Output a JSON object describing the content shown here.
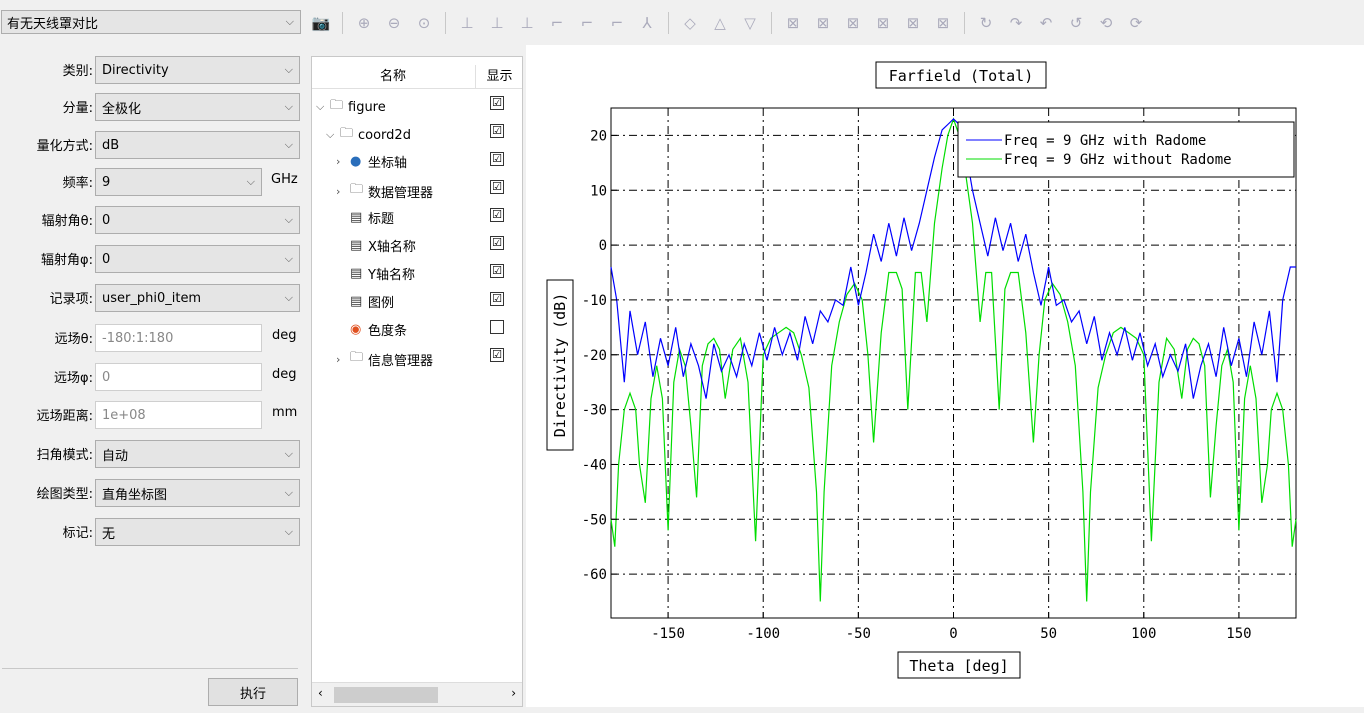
{
  "top_combo": "有无天线罩对比",
  "form": {
    "category_label": "类别:",
    "category_value": "Directivity",
    "component_label": "分量:",
    "component_value": "全极化",
    "quant_label": "量化方式:",
    "quant_value": "dB",
    "freq_label": "频率:",
    "freq_value": "9",
    "freq_unit": "GHz",
    "theta_label": "辐射角θ:",
    "theta_value": "0",
    "phi_label": "辐射角φ:",
    "phi_value": "0",
    "record_label": "记录项:",
    "record_value": "user_phi0_item",
    "ff_theta_label": "远场θ:",
    "ff_theta_value": "-180:1:180",
    "ff_theta_unit": "deg",
    "ff_phi_label": "远场φ:",
    "ff_phi_value": "0",
    "ff_phi_unit": "deg",
    "ff_dist_label": "远场距离:",
    "ff_dist_value": "1e+08",
    "ff_dist_unit": "mm",
    "scan_label": "扫角模式:",
    "scan_value": "自动",
    "plot_type_label": "绘图类型:",
    "plot_type_value": "直角坐标图",
    "marker_label": "标记:",
    "marker_value": "无",
    "exec_label": "执行"
  },
  "tree": {
    "col_name": "名称",
    "col_show": "显示",
    "items": [
      {
        "label": "figure",
        "checked": "☑"
      },
      {
        "label": "coord2d",
        "checked": "☑"
      },
      {
        "label": "坐标轴",
        "checked": "☑"
      },
      {
        "label": "数据管理器",
        "checked": "☑"
      },
      {
        "label": "标题",
        "checked": "☑"
      },
      {
        "label": "X轴名称",
        "checked": "☑"
      },
      {
        "label": "Y轴名称",
        "checked": "☑"
      },
      {
        "label": "图例",
        "checked": "☑"
      },
      {
        "label": "色度条",
        "checked": ""
      },
      {
        "label": "信息管理器",
        "checked": "☑"
      }
    ]
  },
  "chart_data": {
    "type": "line",
    "title": "Farfield (Total)",
    "xlabel": "Theta [deg]",
    "ylabel": "Directivity (dB)",
    "xlim": [
      -180,
      180
    ],
    "ylim": [
      -68,
      25
    ],
    "xticks": [
      -150,
      -100,
      -50,
      0,
      50,
      100,
      150
    ],
    "yticks": [
      20,
      10,
      0,
      -10,
      -20,
      -30,
      -40,
      -50,
      -60
    ],
    "grid": true,
    "legend_position": "top-right",
    "series": [
      {
        "name": "Freq = 9 GHz with Radome",
        "color": "#0000ff",
        "x": [
          -180,
          -177,
          -173,
          -170,
          -166,
          -162,
          -158,
          -154,
          -150,
          -146,
          -142,
          -138,
          -134,
          -130,
          -126,
          -122,
          -118,
          -114,
          -110,
          -106,
          -102,
          -98,
          -94,
          -90,
          -86,
          -82,
          -78,
          -74,
          -70,
          -66,
          -62,
          -58,
          -54,
          -50,
          -46,
          -42,
          -38,
          -34,
          -30,
          -26,
          -22,
          -18,
          -14,
          -10,
          -6,
          -3,
          0,
          3,
          6,
          10,
          14,
          18,
          22,
          26,
          30,
          34,
          38,
          42,
          46,
          50,
          54,
          58,
          62,
          66,
          70,
          74,
          78,
          82,
          86,
          90,
          94,
          98,
          102,
          106,
          110,
          114,
          118,
          122,
          126,
          130,
          134,
          138,
          142,
          146,
          150,
          154,
          158,
          162,
          166,
          170,
          173,
          177,
          180
        ],
        "y": [
          -4,
          -10,
          -25,
          -12,
          -20,
          -14,
          -24,
          -17,
          -22,
          -15,
          -24,
          -18,
          -22,
          -28,
          -18,
          -23,
          -20,
          -24,
          -18,
          -22,
          -16,
          -21,
          -15,
          -20,
          -16,
          -21,
          -13,
          -18,
          -12,
          -14,
          -10,
          -11,
          -4,
          -11,
          -5,
          2,
          -3,
          4,
          -2,
          5,
          -1,
          4,
          10,
          16,
          21,
          22,
          23,
          22,
          18,
          10,
          4,
          -2,
          5,
          -1,
          4,
          -3,
          2,
          -5,
          -11,
          -4,
          -11,
          -10,
          -14,
          -12,
          -18,
          -13,
          -21,
          -16,
          -20,
          -15,
          -21,
          -16,
          -22,
          -18,
          -24,
          -20,
          -23,
          -18,
          -28,
          -22,
          -18,
          -24,
          -15,
          -22,
          -17,
          -24,
          -14,
          -20,
          -12,
          -25,
          -10,
          -4,
          -4
        ]
      },
      {
        "name": "Freq = 9 GHz without Radome",
        "color": "#00dd00",
        "x": [
          -180,
          -178,
          -176,
          -173,
          -170,
          -167,
          -165,
          -162,
          -159,
          -156,
          -153,
          -150,
          -147,
          -144,
          -141,
          -138,
          -135,
          -132,
          -129,
          -126,
          -123,
          -120,
          -116,
          -112,
          -108,
          -104,
          -100,
          -96,
          -92,
          -88,
          -84,
          -80,
          -76,
          -72,
          -70,
          -68,
          -64,
          -60,
          -56,
          -52,
          -48,
          -45,
          -42,
          -38,
          -34,
          -30,
          -27,
          -24,
          -20,
          -17,
          -14,
          -10,
          -6,
          -3,
          0,
          3,
          6,
          10,
          14,
          17,
          20,
          24,
          27,
          30,
          34,
          38,
          42,
          45,
          48,
          52,
          56,
          60,
          64,
          68,
          70,
          72,
          76,
          80,
          84,
          88,
          92,
          96,
          100,
          104,
          108,
          112,
          116,
          120,
          123,
          126,
          129,
          132,
          135,
          138,
          141,
          144,
          147,
          150,
          153,
          156,
          159,
          162,
          165,
          167,
          170,
          173,
          176,
          178,
          180
        ],
        "y": [
          -50,
          -55,
          -40,
          -30,
          -27,
          -30,
          -40,
          -47,
          -28,
          -22,
          -28,
          -52,
          -25,
          -19,
          -22,
          -33,
          -46,
          -22,
          -18,
          -17,
          -19,
          -28,
          -19,
          -17,
          -25,
          -54,
          -20,
          -17,
          -16,
          -15,
          -16,
          -20,
          -26,
          -45,
          -65,
          -45,
          -22,
          -14,
          -9,
          -7,
          -10,
          -20,
          -36,
          -16,
          -5,
          -5,
          -8,
          -30,
          -5,
          -5,
          -14,
          4,
          14,
          20,
          23,
          20,
          14,
          4,
          -14,
          -5,
          -5,
          -30,
          -8,
          -5,
          -5,
          -16,
          -36,
          -20,
          -10,
          -7,
          -9,
          -14,
          -22,
          -45,
          -65,
          -45,
          -26,
          -20,
          -16,
          -15,
          -16,
          -17,
          -20,
          -54,
          -25,
          -17,
          -19,
          -28,
          -19,
          -17,
          -18,
          -22,
          -46,
          -33,
          -22,
          -19,
          -25,
          -52,
          -28,
          -22,
          -28,
          -47,
          -40,
          -30,
          -27,
          -30,
          -40,
          -55,
          -50
        ]
      }
    ]
  }
}
